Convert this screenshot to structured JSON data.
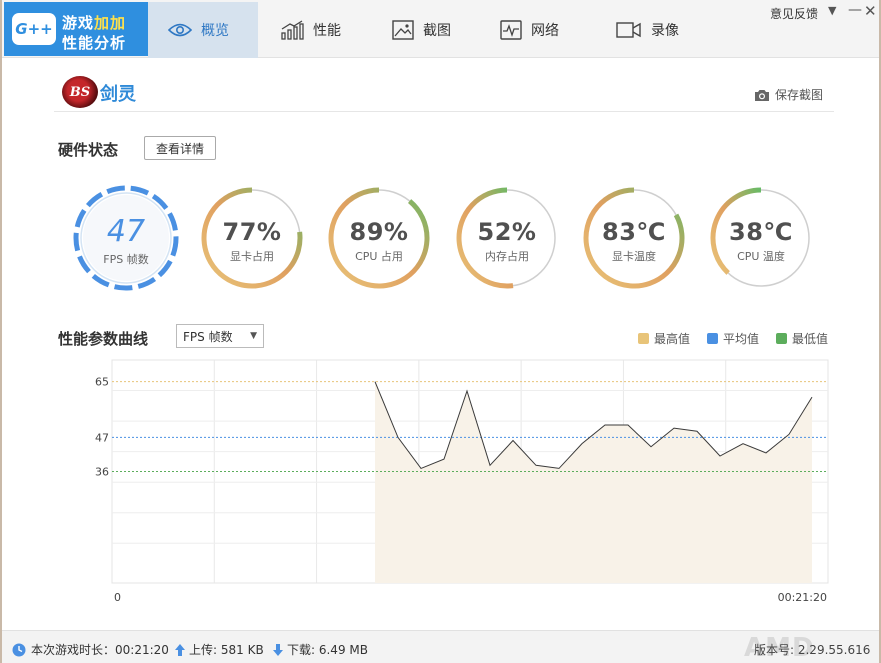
{
  "app": {
    "logo_badge": "G++",
    "logo_line1_a": "游戏",
    "logo_line1_b": "加加",
    "logo_line2": "性能分析",
    "tabs": [
      {
        "label": "概览",
        "icon": "eye-icon",
        "active": true
      },
      {
        "label": "性能",
        "icon": "bar-chart-icon",
        "active": false
      },
      {
        "label": "截图",
        "icon": "image-icon",
        "active": false
      },
      {
        "label": "网络",
        "icon": "pulse-icon",
        "active": false
      },
      {
        "label": "录像",
        "icon": "video-camera-icon",
        "active": false
      }
    ],
    "feedback": "意见反馈",
    "accent": "#2f8fdf"
  },
  "game": {
    "logo_text": "BS",
    "name": "剑灵",
    "save_screenshot": "保存截图"
  },
  "hardware": {
    "title": "硬件状态",
    "detail_button": "查看详情",
    "fps": {
      "value": "47",
      "label": "FPS 帧数"
    },
    "gauges": [
      {
        "value": "77%",
        "label": "显卡占用",
        "level": 0.77
      },
      {
        "value": "89%",
        "label": "CPU 占用",
        "level": 0.89
      },
      {
        "value": "52%",
        "label": "内存占用",
        "level": 0.52
      },
      {
        "value": "83℃",
        "label": "显卡温度",
        "level": 0.83
      },
      {
        "value": "38℃",
        "label": "CPU 温度",
        "level": 0.38
      }
    ]
  },
  "curve": {
    "title": "性能参数曲线",
    "metric_selected": "FPS 帧数",
    "legend": [
      {
        "label": "最高值",
        "color": "#e8c479"
      },
      {
        "label": "平均值",
        "color": "#4a90e2"
      },
      {
        "label": "最低值",
        "color": "#5cad5c"
      }
    ]
  },
  "chart_data": {
    "type": "area",
    "y_ticks": [
      65,
      47,
      36
    ],
    "ylim": [
      0,
      72
    ],
    "x_start_label": "0",
    "x_end_label": "00:21:20",
    "max_value": 65,
    "avg_value": 47,
    "min_value": 36,
    "series": [
      {
        "values": [
          65,
          47,
          37,
          40,
          62,
          38,
          46,
          38,
          37,
          45,
          51,
          51,
          44,
          50,
          49,
          41,
          45,
          42,
          48,
          60
        ]
      }
    ]
  },
  "status": {
    "session_label": "本次游戏时长：00:21:20",
    "upload_label": "上传: 581 KB",
    "download_label": "下载: 6.49 MB",
    "version_label": "版本号: 2.29.55.616",
    "brand": "AMD"
  }
}
